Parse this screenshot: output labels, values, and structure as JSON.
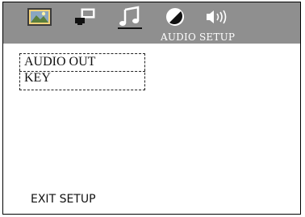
{
  "header": {
    "title": "AUDIO SETUP",
    "tabs": [
      {
        "icon": "picture-icon",
        "active": false
      },
      {
        "icon": "display-icon",
        "active": false
      },
      {
        "icon": "music-note-icon",
        "active": true
      },
      {
        "icon": "brightness-icon",
        "active": false
      },
      {
        "icon": "speaker-icon",
        "active": false
      }
    ]
  },
  "menu": {
    "items": [
      "AUDIO OUT",
      "KEY"
    ]
  },
  "footer": {
    "exit_label": "EXIT SETUP"
  },
  "colors": {
    "header_bg": "#8f8f8f",
    "text": "#111111",
    "title_text": "#ffffff"
  }
}
